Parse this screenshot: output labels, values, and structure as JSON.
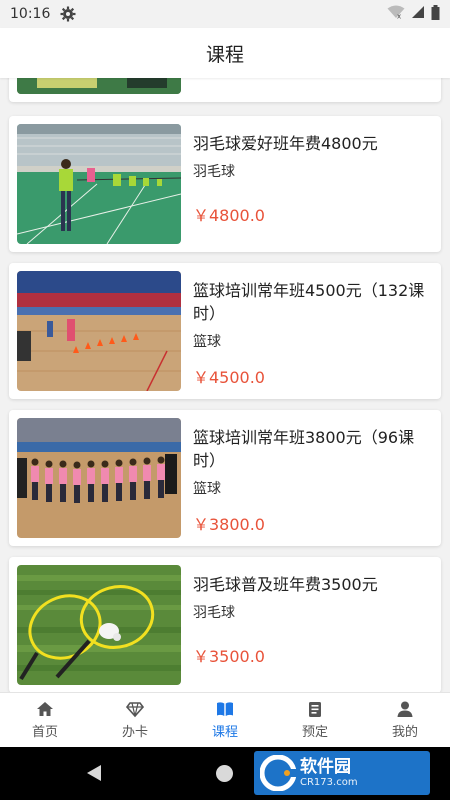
{
  "status_bar": {
    "time": "10:16"
  },
  "header": {
    "title": "课程"
  },
  "courses": [
    {
      "name": "羽毛球爱好班年费4800元",
      "category": "羽毛球",
      "price": "￥4800.0"
    },
    {
      "name": "篮球培训常年班4500元（132课时）",
      "category": "篮球",
      "price": "￥4500.0"
    },
    {
      "name": "篮球培训常年班3800元（96课时）",
      "category": "篮球",
      "price": "￥3800.0"
    },
    {
      "name": "羽毛球普及班年费3500元",
      "category": "羽毛球",
      "price": "￥3500.0"
    }
  ],
  "tabs": [
    {
      "label": "首页",
      "icon": "home-icon"
    },
    {
      "label": "办卡",
      "icon": "diamond-icon"
    },
    {
      "label": "课程",
      "icon": "book-icon",
      "active": true
    },
    {
      "label": "预定",
      "icon": "clipboard-icon"
    },
    {
      "label": "我的",
      "icon": "person-icon"
    }
  ],
  "watermark": {
    "main": "软件园",
    "sub": "CR173.com"
  },
  "colors": {
    "accent": "#1e78e6",
    "price": "#e8533a",
    "watermark_bg": "#1d73c8"
  }
}
